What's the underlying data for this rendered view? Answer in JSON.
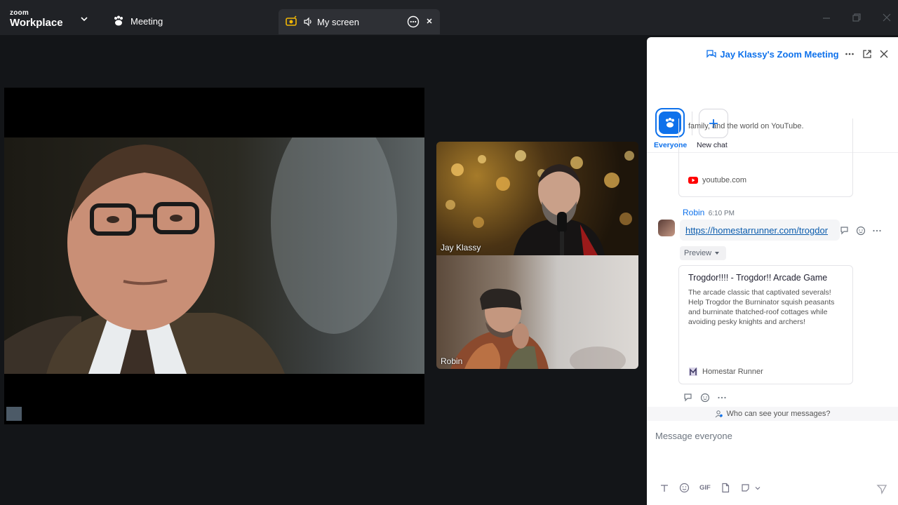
{
  "app": {
    "logo_top": "zoom",
    "logo_bottom": "Workplace",
    "tabs": [
      {
        "label": "Meeting",
        "icon": "meeting-paw-icon"
      },
      {
        "label": "My screen",
        "icon": "screen-share-icon"
      }
    ],
    "window_controls": [
      "minimize",
      "restore",
      "close"
    ]
  },
  "stage": {
    "participants": [
      {
        "name": "Jay Klassy"
      },
      {
        "name": "Robin"
      }
    ]
  },
  "chat": {
    "title": "Jay Klassy's Zoom Meeting",
    "tabs": [
      {
        "label": "Everyone",
        "active": true
      },
      {
        "label": "New chat",
        "active": false
      }
    ],
    "messages": [
      {
        "link_preview": {
          "description_tail": "family, and the world on YouTube.",
          "source": "youtube.com"
        }
      },
      {
        "sender": "Robin",
        "time": "6:10 PM",
        "text": "https://homestarrunner.com/trogdor",
        "preview_label": "Preview",
        "link_preview": {
          "title": "Trogdor!!!! - Trogdor!! Arcade Game",
          "description": "The arcade classic that captivated severals! Help Trogdor the Burninator squish peasants and burninate thatched-roof cottages while avoiding pesky knights and archers!",
          "source": "Homestar Runner"
        }
      }
    ],
    "privacy_note": "Who can see your messages?",
    "input_placeholder": "Message everyone",
    "toolbar": {
      "gif_label": "GIF"
    }
  },
  "colors": {
    "accent": "#0e71eb",
    "titlebar": "#202226",
    "stage_bg": "#131518",
    "panel_bg": "#ffffff",
    "link": "#0b5cad",
    "youtube_red": "#ff0000"
  }
}
